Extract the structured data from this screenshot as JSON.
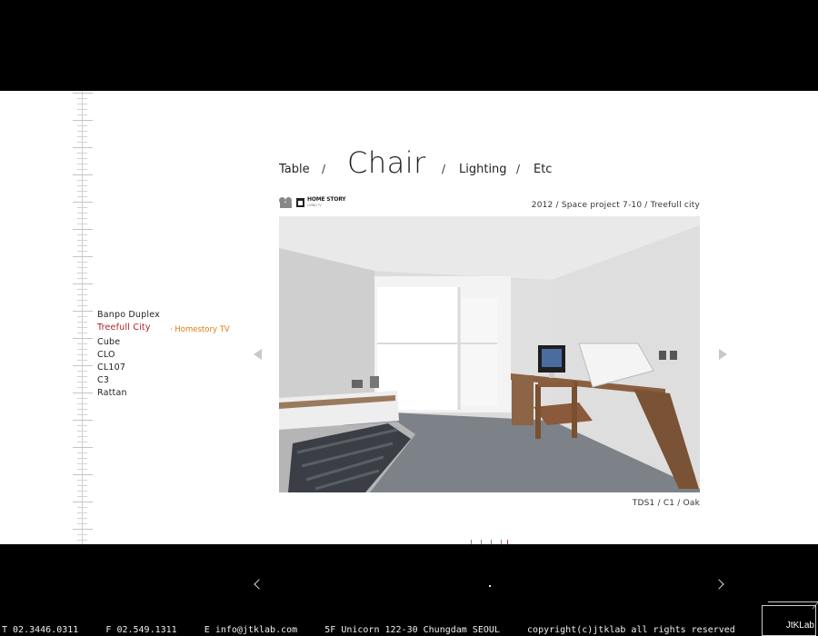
{
  "categories": {
    "table": "Table",
    "chair": "Chair",
    "lighting": "Lighting",
    "etc": "Etc",
    "separator": "/"
  },
  "projects": [
    "Banpo Duplex",
    "Treefull City",
    "Cube",
    "CLO",
    "CL107",
    "C3",
    "Rattan"
  ],
  "active_project_link": "· Homestory TV",
  "homestory_logo": {
    "brand": "HOME STORY",
    "sub": "LIVING TV"
  },
  "project_meta": "2012 / Space project 7-10 / Treefull city",
  "product_caption": "TDS1 / C1 / Oak",
  "footer": {
    "phone": "T  02.3446.0311",
    "fax": "F  02.549.1311",
    "email": "E  info@jtklab.com",
    "address": "5F Unicorn 122-30 Chungdam SEOUL",
    "copyright": "copyright(c)jtklab all rights reserved"
  },
  "logo_text": "JtKLab",
  "colors": {
    "active": "#b02020",
    "link": "#e07a10",
    "panel": "#ffffff",
    "background": "#000000"
  }
}
